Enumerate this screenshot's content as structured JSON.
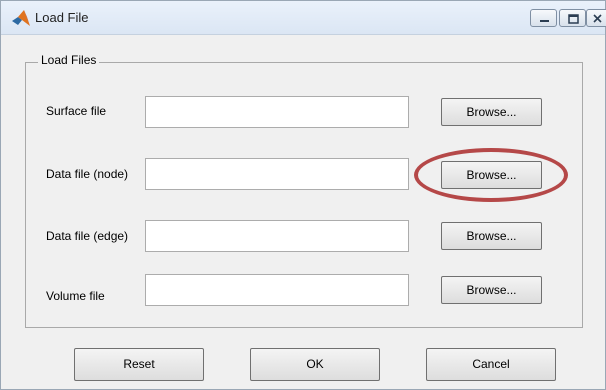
{
  "window": {
    "title": "Load File",
    "icon": "matlab-icon",
    "controls": {
      "minimize": "minimize-icon",
      "maximize": "maximize-icon",
      "close": "close-icon"
    }
  },
  "group": {
    "label": "Load Files"
  },
  "fields": [
    {
      "label": "Surface file",
      "value": "",
      "button": "Browse..."
    },
    {
      "label": "Data file (node)",
      "value": "",
      "button": "Browse..."
    },
    {
      "label": "Data file (edge)",
      "value": "",
      "button": "Browse..."
    },
    {
      "label": "Volume file",
      "value": "",
      "button": "Browse..."
    }
  ],
  "actions": {
    "reset": "Reset",
    "ok": "OK",
    "cancel": "Cancel"
  },
  "annotation": {
    "color": "#b54848",
    "target": "Data file (node) Browse button"
  },
  "colors": {
    "window_bg": "#f0f0f0",
    "titlebar": "#dbe6f4",
    "highlight": "#b54848"
  }
}
